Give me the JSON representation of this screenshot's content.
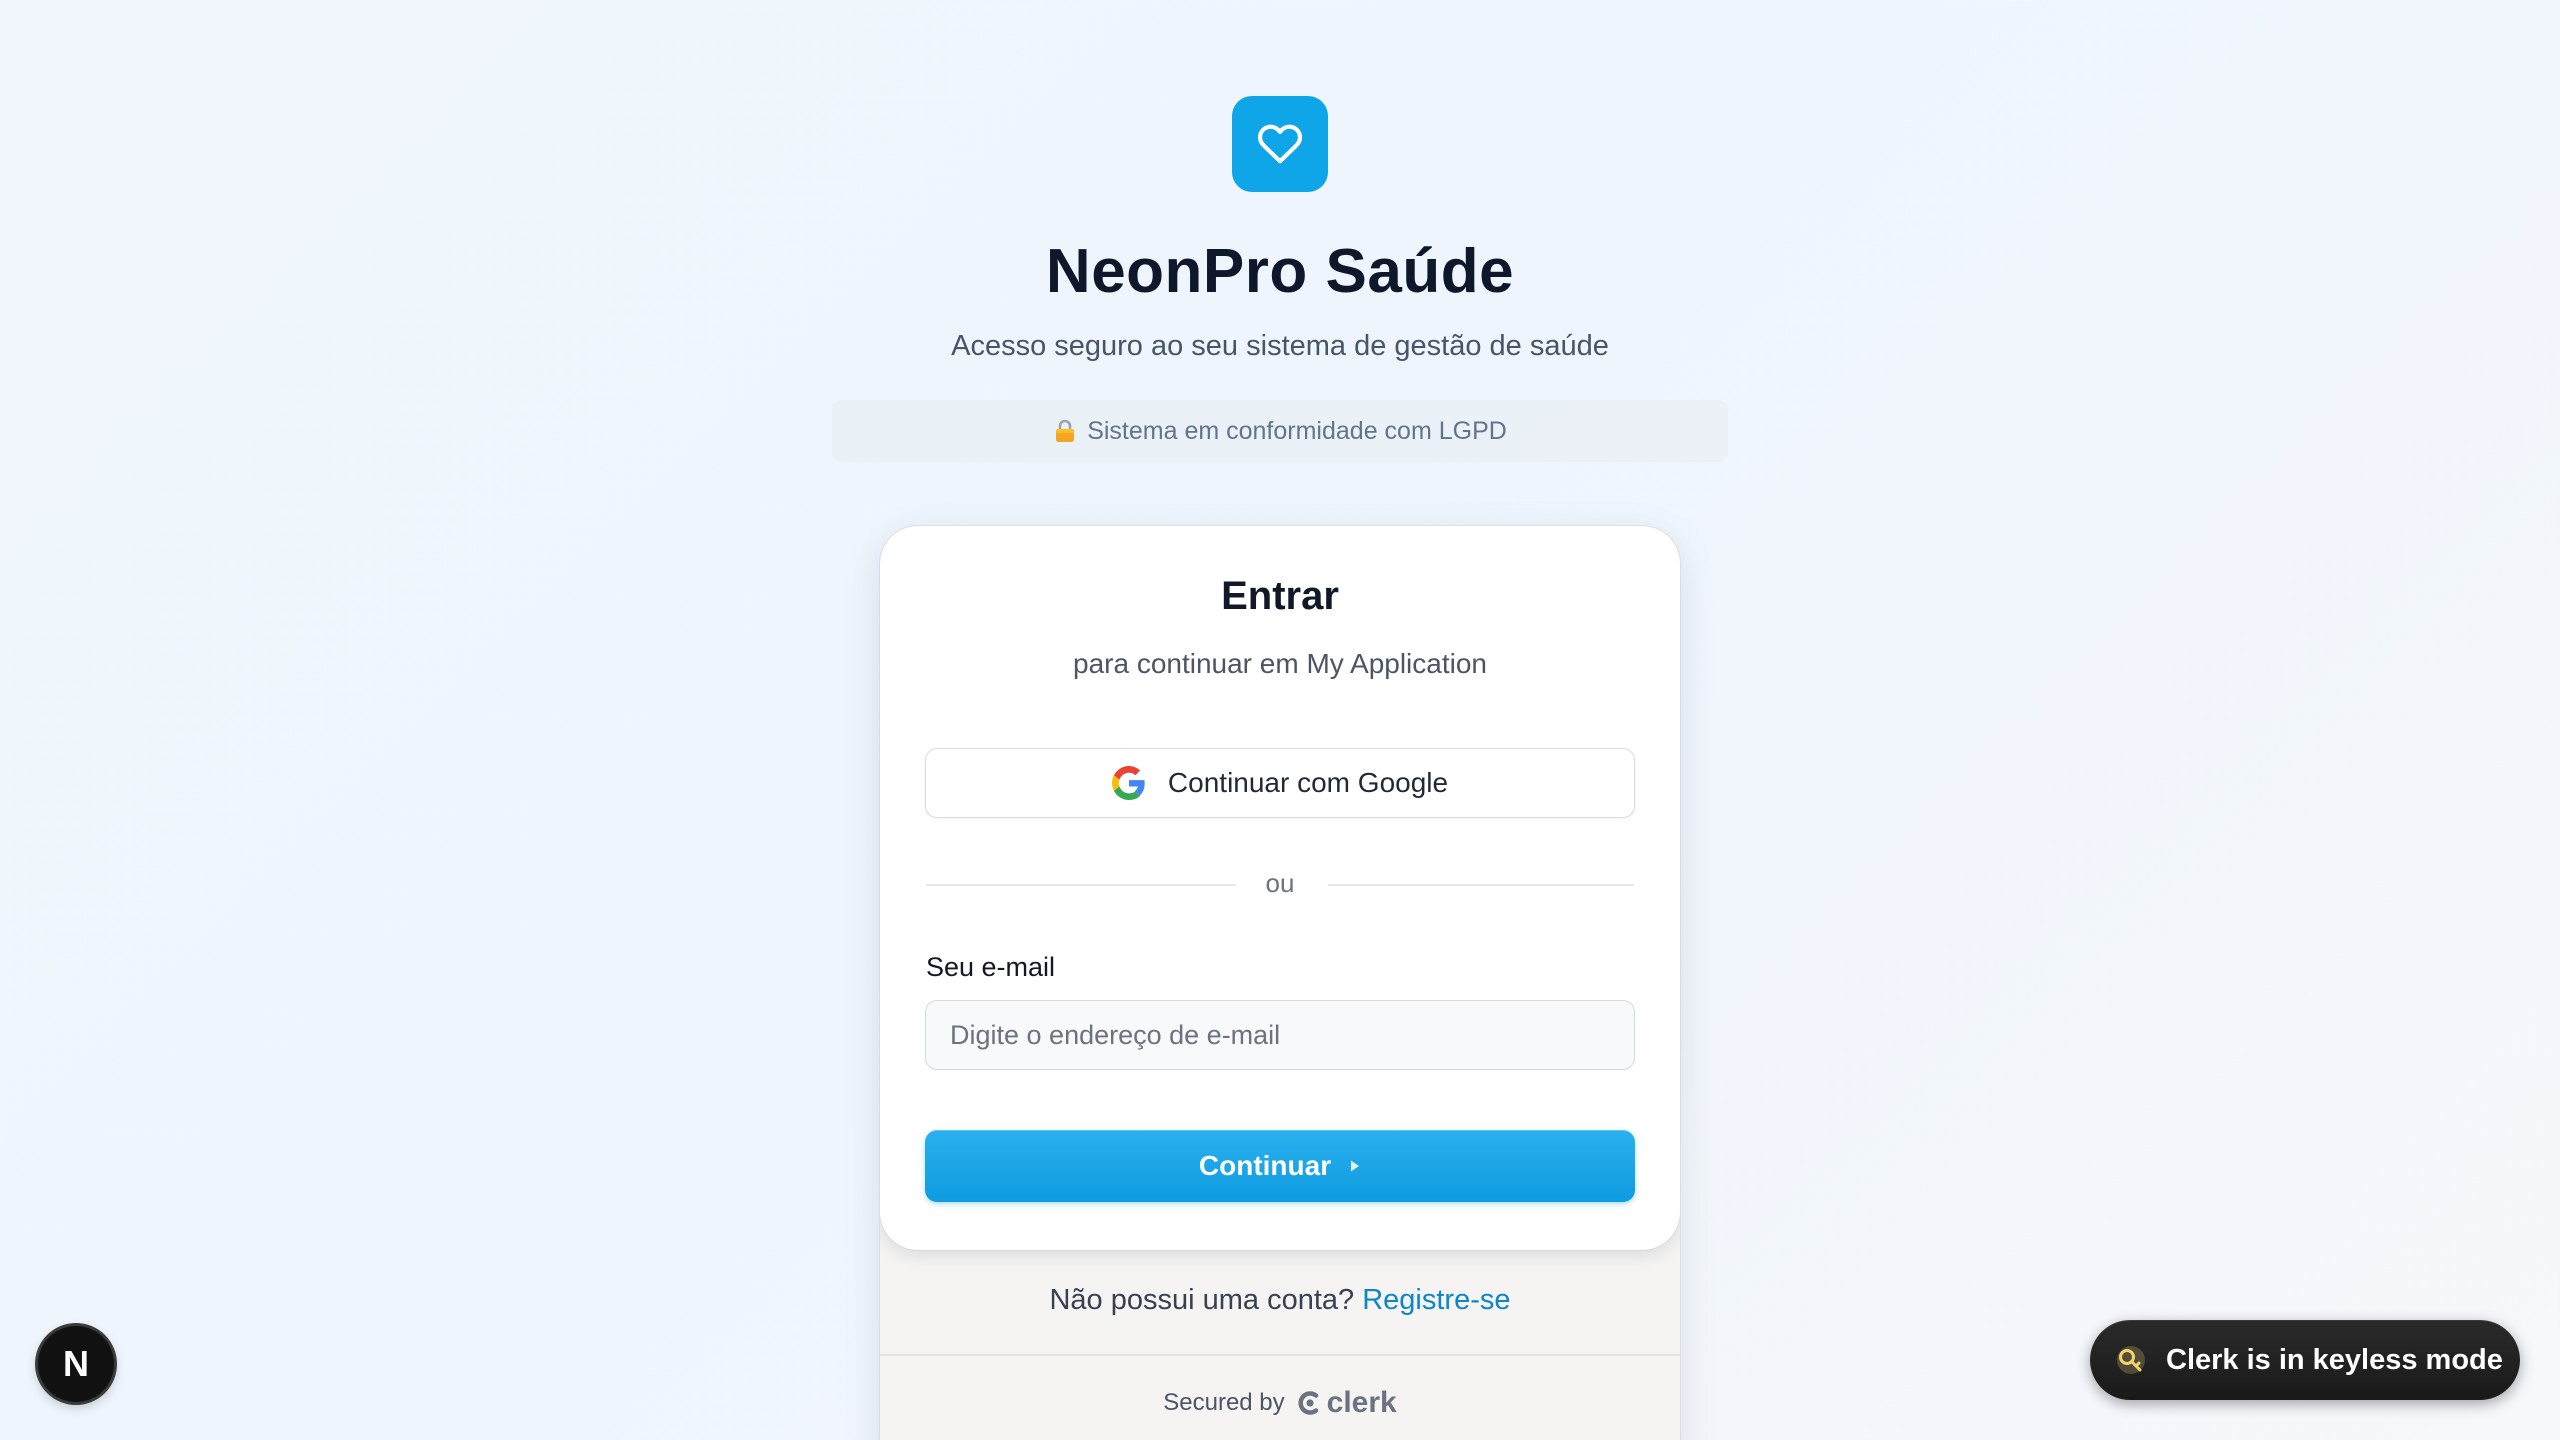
{
  "brand": {
    "logo_icon": "heart-icon",
    "title": "NeonPro Saúde",
    "subtitle": "Acesso seguro ao seu sistema de gestão de saúde"
  },
  "lgpd": {
    "icon": "lock-icon",
    "text": "Sistema em conformidade com LGPD"
  },
  "signin": {
    "title": "Entrar",
    "subtitle": "para continuar em My Application",
    "google_button": "Continuar com Google",
    "divider": "ou",
    "email_label": "Seu e-mail",
    "email_placeholder": "Digite o endereço de e-mail",
    "email_value": "",
    "continue_button": "Continuar",
    "no_account_text": "Não possui uma conta?",
    "register_link": "Registre-se",
    "secured_by": "Secured by",
    "clerk_brand": "clerk"
  },
  "devtools": {
    "next_badge": "N",
    "keyless_text": "Clerk is in keyless mode"
  },
  "colors": {
    "accent": "#0ea5e9",
    "link": "#0b86c6",
    "title": "#0f172a"
  }
}
